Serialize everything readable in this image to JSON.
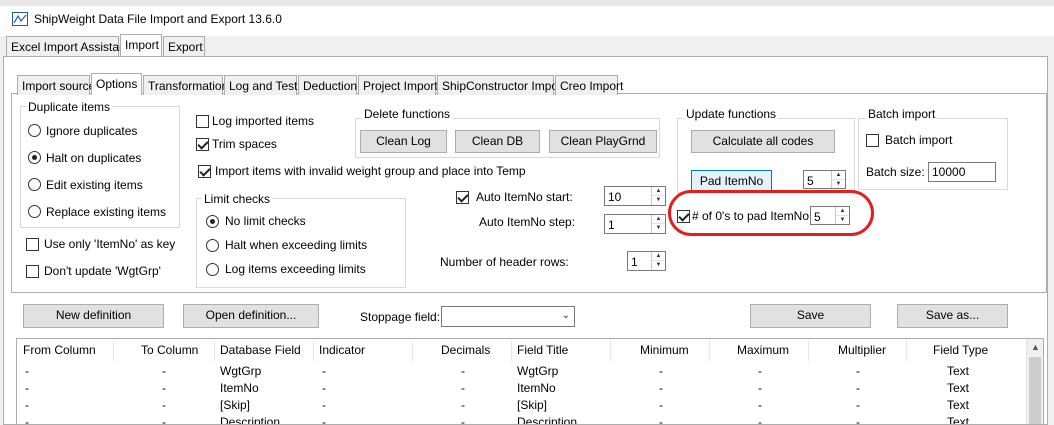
{
  "window": {
    "title": "ShipWeight Data File Import and Export 13.6.0"
  },
  "main_tabs": [
    "Excel Import Assistant",
    "Import",
    "Export"
  ],
  "sub_tabs": [
    "Import source",
    "Options",
    "Transformation",
    "Log and Test",
    "Deduction",
    "Project Import",
    "ShipConstructor Import",
    "Creo Import"
  ],
  "duplicate_items": {
    "title": "Duplicate items",
    "options": [
      "Ignore duplicates",
      "Halt on duplicates",
      "Edit existing items",
      "Replace existing items"
    ],
    "selected": "Halt on duplicates"
  },
  "standalone_checks": {
    "use_only_itemno": {
      "label": "Use only 'ItemNo' as key",
      "checked": false
    },
    "dont_update_wgtgrp": {
      "label": "Don't update 'WgtGrp'",
      "checked": false
    },
    "log_imported": {
      "label": "Log imported items",
      "checked": false
    },
    "trim_spaces": {
      "label": "Trim spaces",
      "checked": true
    },
    "import_invalid": {
      "label": "Import items with invalid weight group and place into Temp",
      "checked": true
    }
  },
  "delete_functions": {
    "title": "Delete functions",
    "buttons": [
      "Clean Log",
      "Clean DB",
      "Clean PlayGrnd"
    ]
  },
  "update_functions": {
    "title": "Update functions",
    "calc_button": "Calculate all codes",
    "pad_button": "Pad ItemNo",
    "pad_value": "5"
  },
  "batch_import": {
    "title": "Batch import",
    "check_label": "Batch import",
    "checked": false,
    "size_label": "Batch size:",
    "size_value": "10000"
  },
  "limit_checks": {
    "title": "Limit checks",
    "options": [
      "No limit checks",
      "Halt when exceeding limits",
      "Log items exceeding limits"
    ],
    "selected": "No limit checks"
  },
  "auto_itemno": {
    "start_label": "Auto ItemNo start:",
    "start_checked": true,
    "start_value": "10",
    "step_label": "Auto ItemNo step:",
    "step_value": "1"
  },
  "pad_zeros": {
    "label": "# of 0's to pad ItemNo:",
    "checked": true,
    "value": "5"
  },
  "header_rows": {
    "label": "Number of  header rows:",
    "value": "1"
  },
  "definition_bar": {
    "new_button": "New definition",
    "open_button": "Open definition...",
    "stoppage_label": "Stoppage field:",
    "stoppage_value": "",
    "save_button": "Save",
    "save_as_button": "Save as..."
  },
  "grid": {
    "columns": [
      "From Column",
      "To Column",
      "Database Field",
      "Indicator",
      "Decimals",
      "Field Title",
      "Minimum",
      "Maximum",
      "Multiplier",
      "Field Type"
    ],
    "rows": [
      [
        "-",
        "-",
        "WgtGrp",
        "-",
        "-",
        "WgtGrp",
        "-",
        "-",
        "-",
        "Text"
      ],
      [
        "-",
        "-",
        "ItemNo",
        "-",
        "-",
        "ItemNo",
        "-",
        "-",
        "-",
        "Text"
      ],
      [
        "-",
        "-",
        "[Skip]",
        "-",
        "-",
        "[Skip]",
        "-",
        "-",
        "-",
        "Text"
      ],
      [
        "-",
        "-",
        "Description",
        "-",
        "-",
        "Description",
        "-",
        "-",
        "-",
        "Text"
      ]
    ]
  },
  "colors": {
    "highlight_ring": "#e02020",
    "focus_border": "#0078d7"
  }
}
